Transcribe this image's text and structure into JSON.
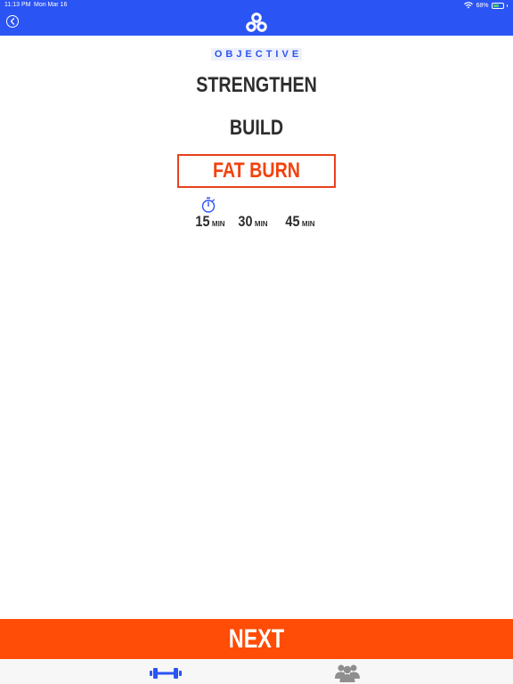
{
  "status": {
    "time": "11:13 PM",
    "date": "Mon Mar 16",
    "battery": "68%",
    "battery_level": 0.68
  },
  "header": {
    "back_icon": "chevron-left-circle-icon",
    "logo_icon": "app-logo-icon"
  },
  "objective": {
    "label": "OBJECTIVE",
    "options": [
      "STRENGTHEN",
      "BUILD",
      "FAT BURN"
    ],
    "selected": "FAT BURN"
  },
  "durations": {
    "icon": "stopwatch-icon",
    "items": [
      {
        "value": "15",
        "unit": "MIN"
      },
      {
        "value": "30",
        "unit": "MIN"
      },
      {
        "value": "45",
        "unit": "MIN"
      }
    ]
  },
  "next_label": "NEXT",
  "tabs": [
    {
      "icon": "dumbbell-icon",
      "active": true
    },
    {
      "icon": "group-icon",
      "active": false
    }
  ],
  "colors": {
    "brand_blue": "#2b54f4",
    "accent_orange": "#ff4c06",
    "selected_red": "#e8401b"
  }
}
